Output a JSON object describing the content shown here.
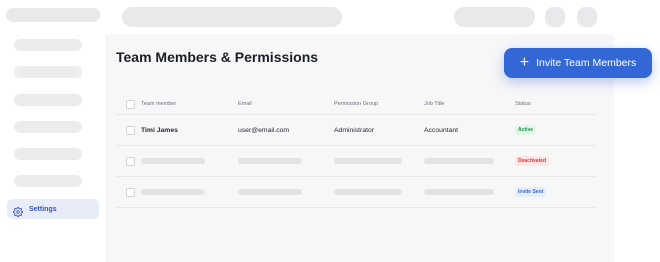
{
  "main": {
    "title": "Team Members & Permissions",
    "invite_button": {
      "icon": "plus-icon",
      "label": "Invite Team Members"
    }
  },
  "sidebar": {
    "active_item": {
      "icon": "gear-icon",
      "label": "Settings"
    }
  },
  "table": {
    "columns": [
      "Team member",
      "Email",
      "Permission Group",
      "Job Title",
      "Status"
    ],
    "rows": [
      {
        "name": "Timi James",
        "email": "user@email.com",
        "permission_group": "Administrator",
        "job_title": "Accountant",
        "status": "Active"
      },
      {
        "status": "Deactivated"
      },
      {
        "status": "Invite Sent"
      }
    ]
  },
  "colors": {
    "accent": "#3467d6",
    "status_active": "#25934e",
    "status_deactivated": "#d63d3d",
    "status_invite_sent": "#3467d6"
  }
}
